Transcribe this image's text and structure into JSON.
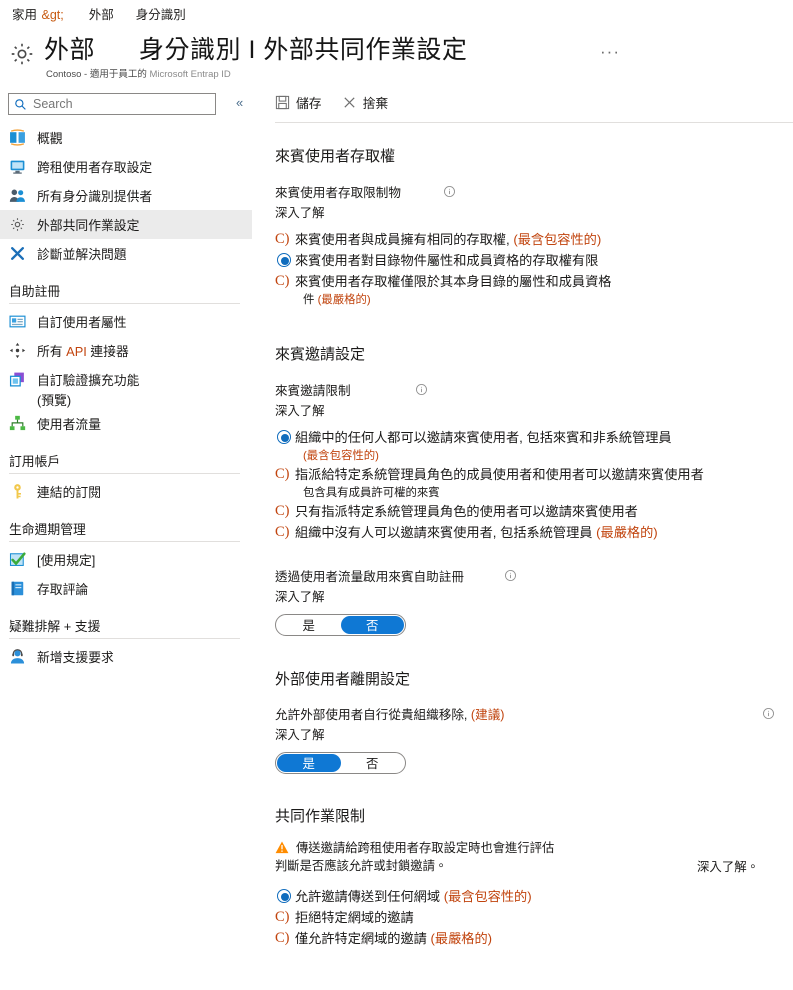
{
  "breadcrumb": {
    "items": [
      "家用 &gt;",
      "外部",
      "身分識別"
    ],
    "separator": "&gt;"
  },
  "header": {
    "icon": "gear-icon",
    "title_main": "外部",
    "title_sub": "身分識別 I 外部共同作業設定",
    "subtitle_org": "Contoso - 適用于員工的",
    "subtitle_dim": "Microsoft Entrap ID",
    "ellipsis": "···"
  },
  "sidebar": {
    "search": {
      "placeholder": "Search",
      "icon": "search-icon"
    },
    "collapse_icon": "chevron-double-left-icon",
    "items": [
      {
        "label": "概觀",
        "icon": "overview-icon",
        "selected": false
      },
      {
        "label": "跨租使用者存取設定",
        "icon": "monitor-icon",
        "selected": false
      },
      {
        "label": "所有身分識別提供者",
        "icon": "people-icon",
        "selected": false
      },
      {
        "label": "外部共同作業設定",
        "icon": "gear-icon",
        "selected": true
      },
      {
        "label": "診斷並解決問題",
        "icon": "wrench-icon",
        "selected": false
      }
    ],
    "groups": [
      {
        "title": "自助註冊",
        "items": [
          {
            "label": "自訂使用者屬性",
            "icon": "id-card-icon",
            "sub": ""
          },
          {
            "label": "所有 API 連接器",
            "icon": "connector-icon",
            "sub": ""
          },
          {
            "label": "自訂驗證擴充功能",
            "icon": "extension-icon",
            "sub": "(預覽)"
          },
          {
            "label": "使用者流量",
            "icon": "flow-icon",
            "sub": ""
          }
        ]
      },
      {
        "title": "訂用帳戶",
        "items": [
          {
            "label": "連結的訂閱",
            "icon": "key-icon",
            "sub": ""
          }
        ]
      },
      {
        "title": "生命週期管理",
        "items": [
          {
            "label": "[使用規定]",
            "icon": "check-box-icon",
            "sub": ""
          },
          {
            "label": "存取評論",
            "icon": "book-icon",
            "sub": ""
          }
        ]
      },
      {
        "title": "疑難排解 + 支援",
        "items": [
          {
            "label": "新增支援要求",
            "icon": "support-person-icon",
            "sub": ""
          }
        ]
      }
    ]
  },
  "toolbar": {
    "save_label": "儲存",
    "save_icon": "save-icon",
    "discard_label": "捨棄",
    "discard_icon": "close-icon"
  },
  "sections": {
    "guest_access": {
      "title": "來賓使用者存取權",
      "field_label": "來賓使用者存取限制物",
      "info_icon": "info-icon",
      "learn_more": "深入了解",
      "options": [
        {
          "selected": false,
          "text": "來賓使用者與成員擁有相同的存取權,",
          "paren": " (最含包容性的)",
          "sub": ""
        },
        {
          "selected": true,
          "text": "來賓使用者對目錄物件屬性和成員資格的存取權有限",
          "paren": "",
          "sub": ""
        },
        {
          "selected": false,
          "text": "來賓使用者存取權僅限於其本身目錄的屬性和成員資格",
          "paren": "",
          "sub": "件",
          "sub_paren": " (最嚴格的)"
        }
      ]
    },
    "guest_invite": {
      "title": "來賓邀請設定",
      "field_label": "來賓邀請限制",
      "info_icon": "info-icon",
      "learn_more": "深入了解",
      "options": [
        {
          "selected": true,
          "text": "組織中的任何人都可以邀請來賓使用者, 包括來賓和非系統管理員",
          "paren": "",
          "sub": "",
          "sub_paren": "(最含包容性的)"
        },
        {
          "selected": false,
          "text": "指派給特定系統管理員角色的成員使用者和使用者可以邀請來賓使用者",
          "paren": "",
          "sub": "包含具有成員許可權的來賓",
          "sub_paren": ""
        },
        {
          "selected": false,
          "text": "只有指派特定系統管理員角色的使用者可以邀請來賓使用者",
          "paren": "",
          "sub": "",
          "sub_paren": ""
        },
        {
          "selected": false,
          "text": "組織中沒有人可以邀請來賓使用者, 包括系統管理員",
          "paren": " (最嚴格的)",
          "sub": "",
          "sub_paren": ""
        }
      ]
    },
    "self_service": {
      "field_label": "透過使用者流量啟用來賓自助註冊",
      "info_icon": "info-icon",
      "learn_more": "深入了解",
      "toggle": {
        "yes": "是",
        "no": "否",
        "value": "否"
      }
    },
    "leave_settings": {
      "title": "外部使用者離開設定",
      "field_label": "允許外部使用者自行從貴組織移除,",
      "field_label_paren": " (建議)",
      "info_icon": "info-icon",
      "learn_more": "深入了解",
      "toggle": {
        "yes": "是",
        "no": "否",
        "value": "是"
      }
    },
    "collab_restrictions": {
      "title": "共同作業限制",
      "warning_icon": "warning-triangle-icon",
      "warning_line1": "傳送邀請給跨租使用者存取設定時也會進行評估",
      "warning_line2": "判斷是否應該允許或封鎖邀請。",
      "learn_more": "深入了解。",
      "options": [
        {
          "selected": true,
          "text": "允許邀請傳送到任何網域",
          "paren": " (最含包容性的)"
        },
        {
          "selected": false,
          "text": "拒絕特定網域的邀請",
          "paren": ""
        },
        {
          "selected": false,
          "text": "僅允許特定網域的邀請",
          "paren": " (最嚴格的)"
        }
      ]
    }
  },
  "colors": {
    "accent": "#0f6cbd",
    "toggle_on": "#0f78d4",
    "warning": "#ff8c00",
    "selected_row": "#ebebeb"
  }
}
